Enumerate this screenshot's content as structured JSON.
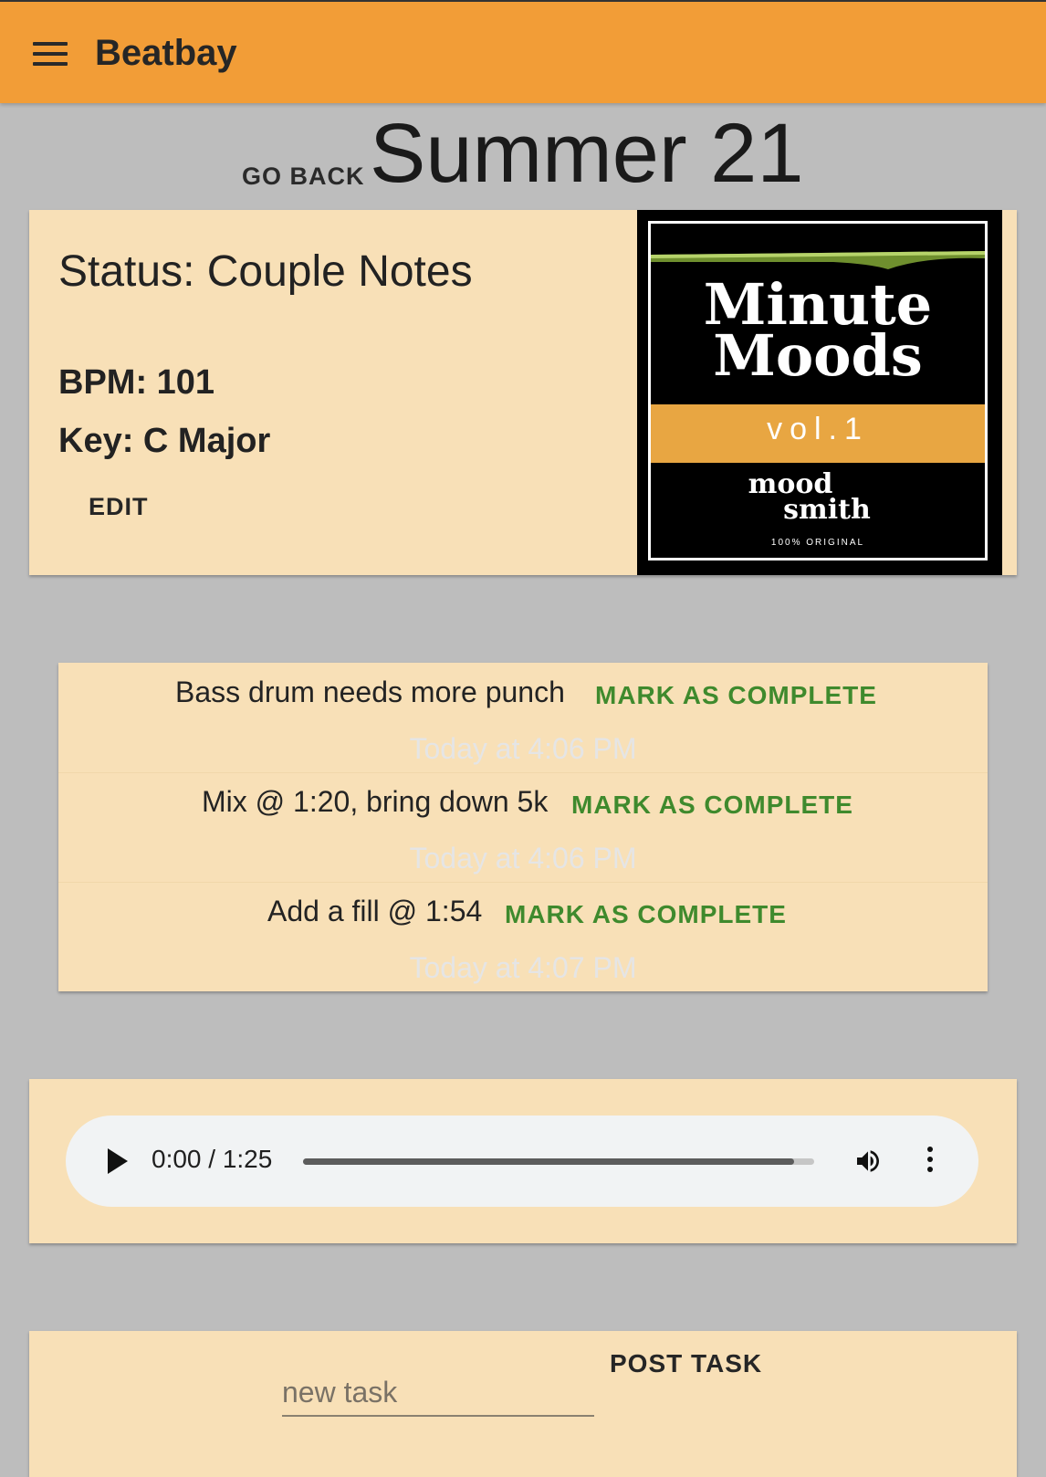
{
  "app": {
    "title": "Beatbay",
    "brand_color": "#f29d37"
  },
  "header": {
    "go_back_label": "GO BACK",
    "title": "Summer 21"
  },
  "info": {
    "status": "Status: Couple Notes",
    "bpm": "BPM: 101",
    "key": "Key: C Major",
    "edit_label": "EDIT",
    "cover": {
      "line1": "Minute",
      "line2": "Moods",
      "volume": "vol.1",
      "brand_line1": "mood",
      "brand_line2": "smith",
      "tagline": "100% ORIGINAL"
    }
  },
  "tasks": [
    {
      "text": "Bass drum needs more punch",
      "action": "MARK AS COMPLETE",
      "time": "Today at 4:06 PM"
    },
    {
      "text": "Mix @ 1:20, bring down 5k",
      "action": "MARK AS COMPLETE",
      "time": "Today at 4:06 PM"
    },
    {
      "text": "Add a fill @ 1:54",
      "action": "MARK AS COMPLETE",
      "time": "Today at 4:07 PM"
    }
  ],
  "player": {
    "time": "0:00 / 1:25",
    "progress_fraction": 0.96,
    "icons": [
      "play-icon",
      "volume-icon",
      "more-vert-icon"
    ]
  },
  "new_task": {
    "placeholder": "new task",
    "post_label": "POST TASK"
  },
  "colors": {
    "card": "#f8e0b7",
    "action_green": "#3f8a2d",
    "background": "#bdbdbd"
  }
}
